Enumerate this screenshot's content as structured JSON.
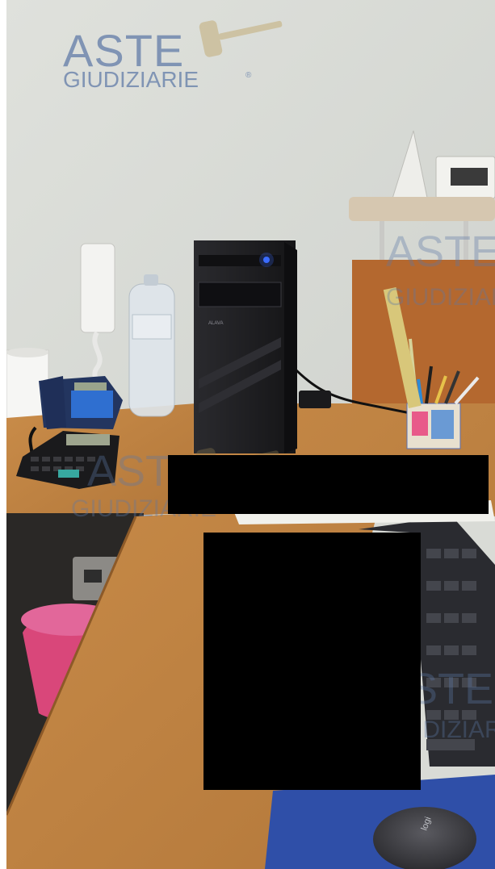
{
  "watermark": {
    "line1": "ASTE",
    "line2": "GIUDIZIARIE",
    "registered_mark": "®",
    "color": "#5d78a6"
  },
  "pc_case_brand": "ALAVA",
  "colors": {
    "wall": "#d8dad5",
    "desk": "#c08442",
    "carpet": "#2f4fa8",
    "pc_case": "#1d1d20",
    "power_led": "#3b6cff"
  }
}
